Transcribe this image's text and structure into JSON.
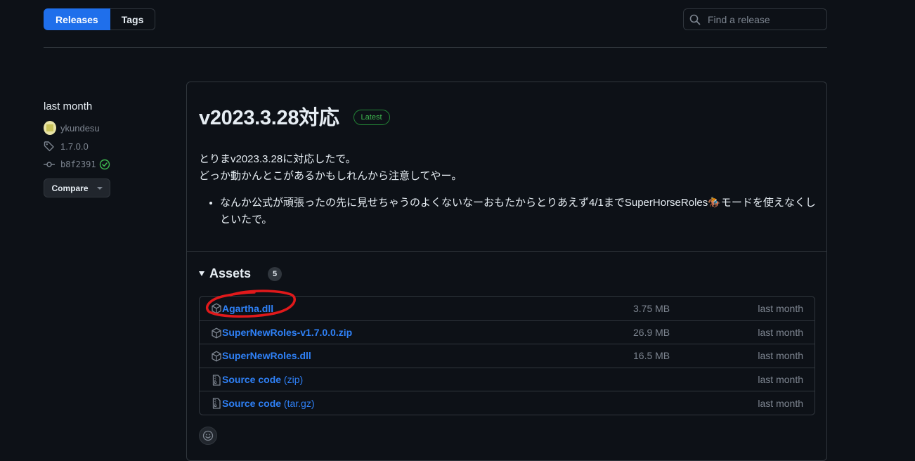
{
  "tabs": [
    {
      "label": "Releases",
      "active": true
    },
    {
      "label": "Tags",
      "active": false
    }
  ],
  "search": {
    "placeholder": "Find a release",
    "value": ""
  },
  "meta": {
    "date": "last month",
    "author": "ykundesu",
    "tag": "1.7.0.0",
    "commit": "b8f2391",
    "compare_label": "Compare"
  },
  "release": {
    "title": "v2023.3.28対応",
    "badge": "Latest",
    "body_line1": "とりまv2023.3.28に対応したで。",
    "body_line2": "どっか動かんとこがあるかもしれんから注意してやー。",
    "bullet": "なんか公式が頑張ったの先に見せちゃうのよくないなーおもたからとりあえず4/1までSuperHorseRoles🏇モードを使えなくしといたで。"
  },
  "assets": {
    "heading": "Assets",
    "count": "5",
    "items": [
      {
        "name": "Agartha.dll",
        "sub": "",
        "size": "3.75 MB",
        "when": "last month",
        "icon": "package-icon"
      },
      {
        "name": "SuperNewRoles-v1.7.0.0.zip",
        "sub": "",
        "size": "26.9 MB",
        "when": "last month",
        "icon": "package-icon"
      },
      {
        "name": "SuperNewRoles.dll",
        "sub": "",
        "size": "16.5 MB",
        "when": "last month",
        "icon": "package-icon"
      },
      {
        "name": "Source code",
        "sub": " (zip)",
        "size": "",
        "when": "last month",
        "icon": "file-zip-icon"
      },
      {
        "name": "Source code",
        "sub": " (tar.gz)",
        "size": "",
        "when": "last month",
        "icon": "file-zip-icon"
      }
    ]
  },
  "colors": {
    "accent": "#1f6feb",
    "link": "#2f81f7",
    "latest": "#3fb950",
    "annotation": "#e0191b"
  }
}
